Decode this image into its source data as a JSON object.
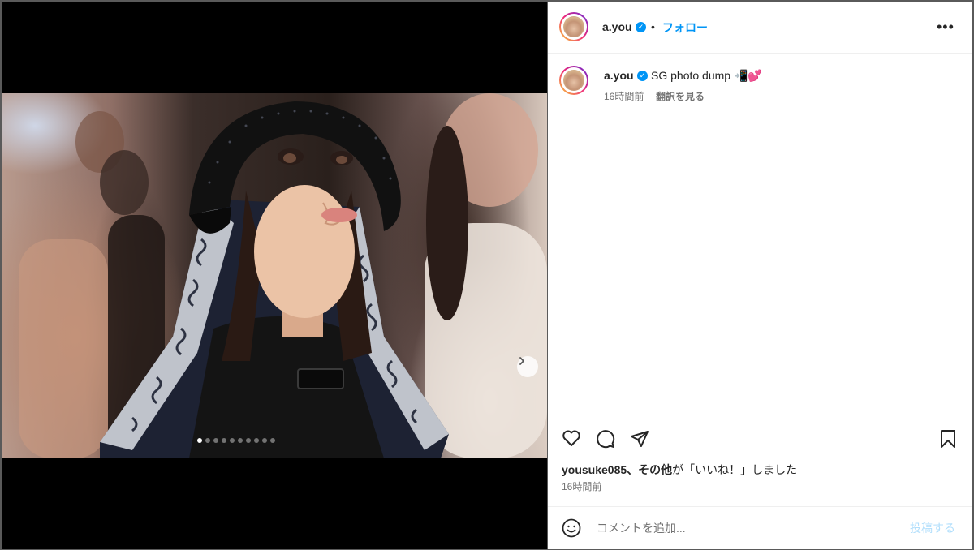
{
  "post": {
    "username": "a.you",
    "separator": "•",
    "follow_label": "フォロー",
    "more_icon": "more-horizontal-icon",
    "more_glyph": "•••",
    "caption": {
      "username": "a.you",
      "text": "SG photo dump 📲💕",
      "time": "16時間前",
      "translate_label": "翻訳を見る"
    },
    "media": {
      "slide_count": 10,
      "active_slide": 1,
      "next_icon": "chevron-right-icon"
    },
    "actions": {
      "like_icon": "heart-icon",
      "comment_icon": "comment-icon",
      "share_icon": "paper-plane-icon",
      "save_icon": "bookmark-icon"
    },
    "likes": {
      "user": "yousuke085",
      "mid": "、",
      "others": "その他",
      "suffix": "が「いいね！」しました"
    },
    "posted_time": "16時間前",
    "comment": {
      "emoji_icon": "emoji-smile-icon",
      "placeholder": "コメントを追加...",
      "post_label": "投稿する"
    }
  },
  "colors": {
    "accent": "#0095f6",
    "post_disabled": "#b2dffc",
    "text": "#262626",
    "muted": "#737373"
  }
}
